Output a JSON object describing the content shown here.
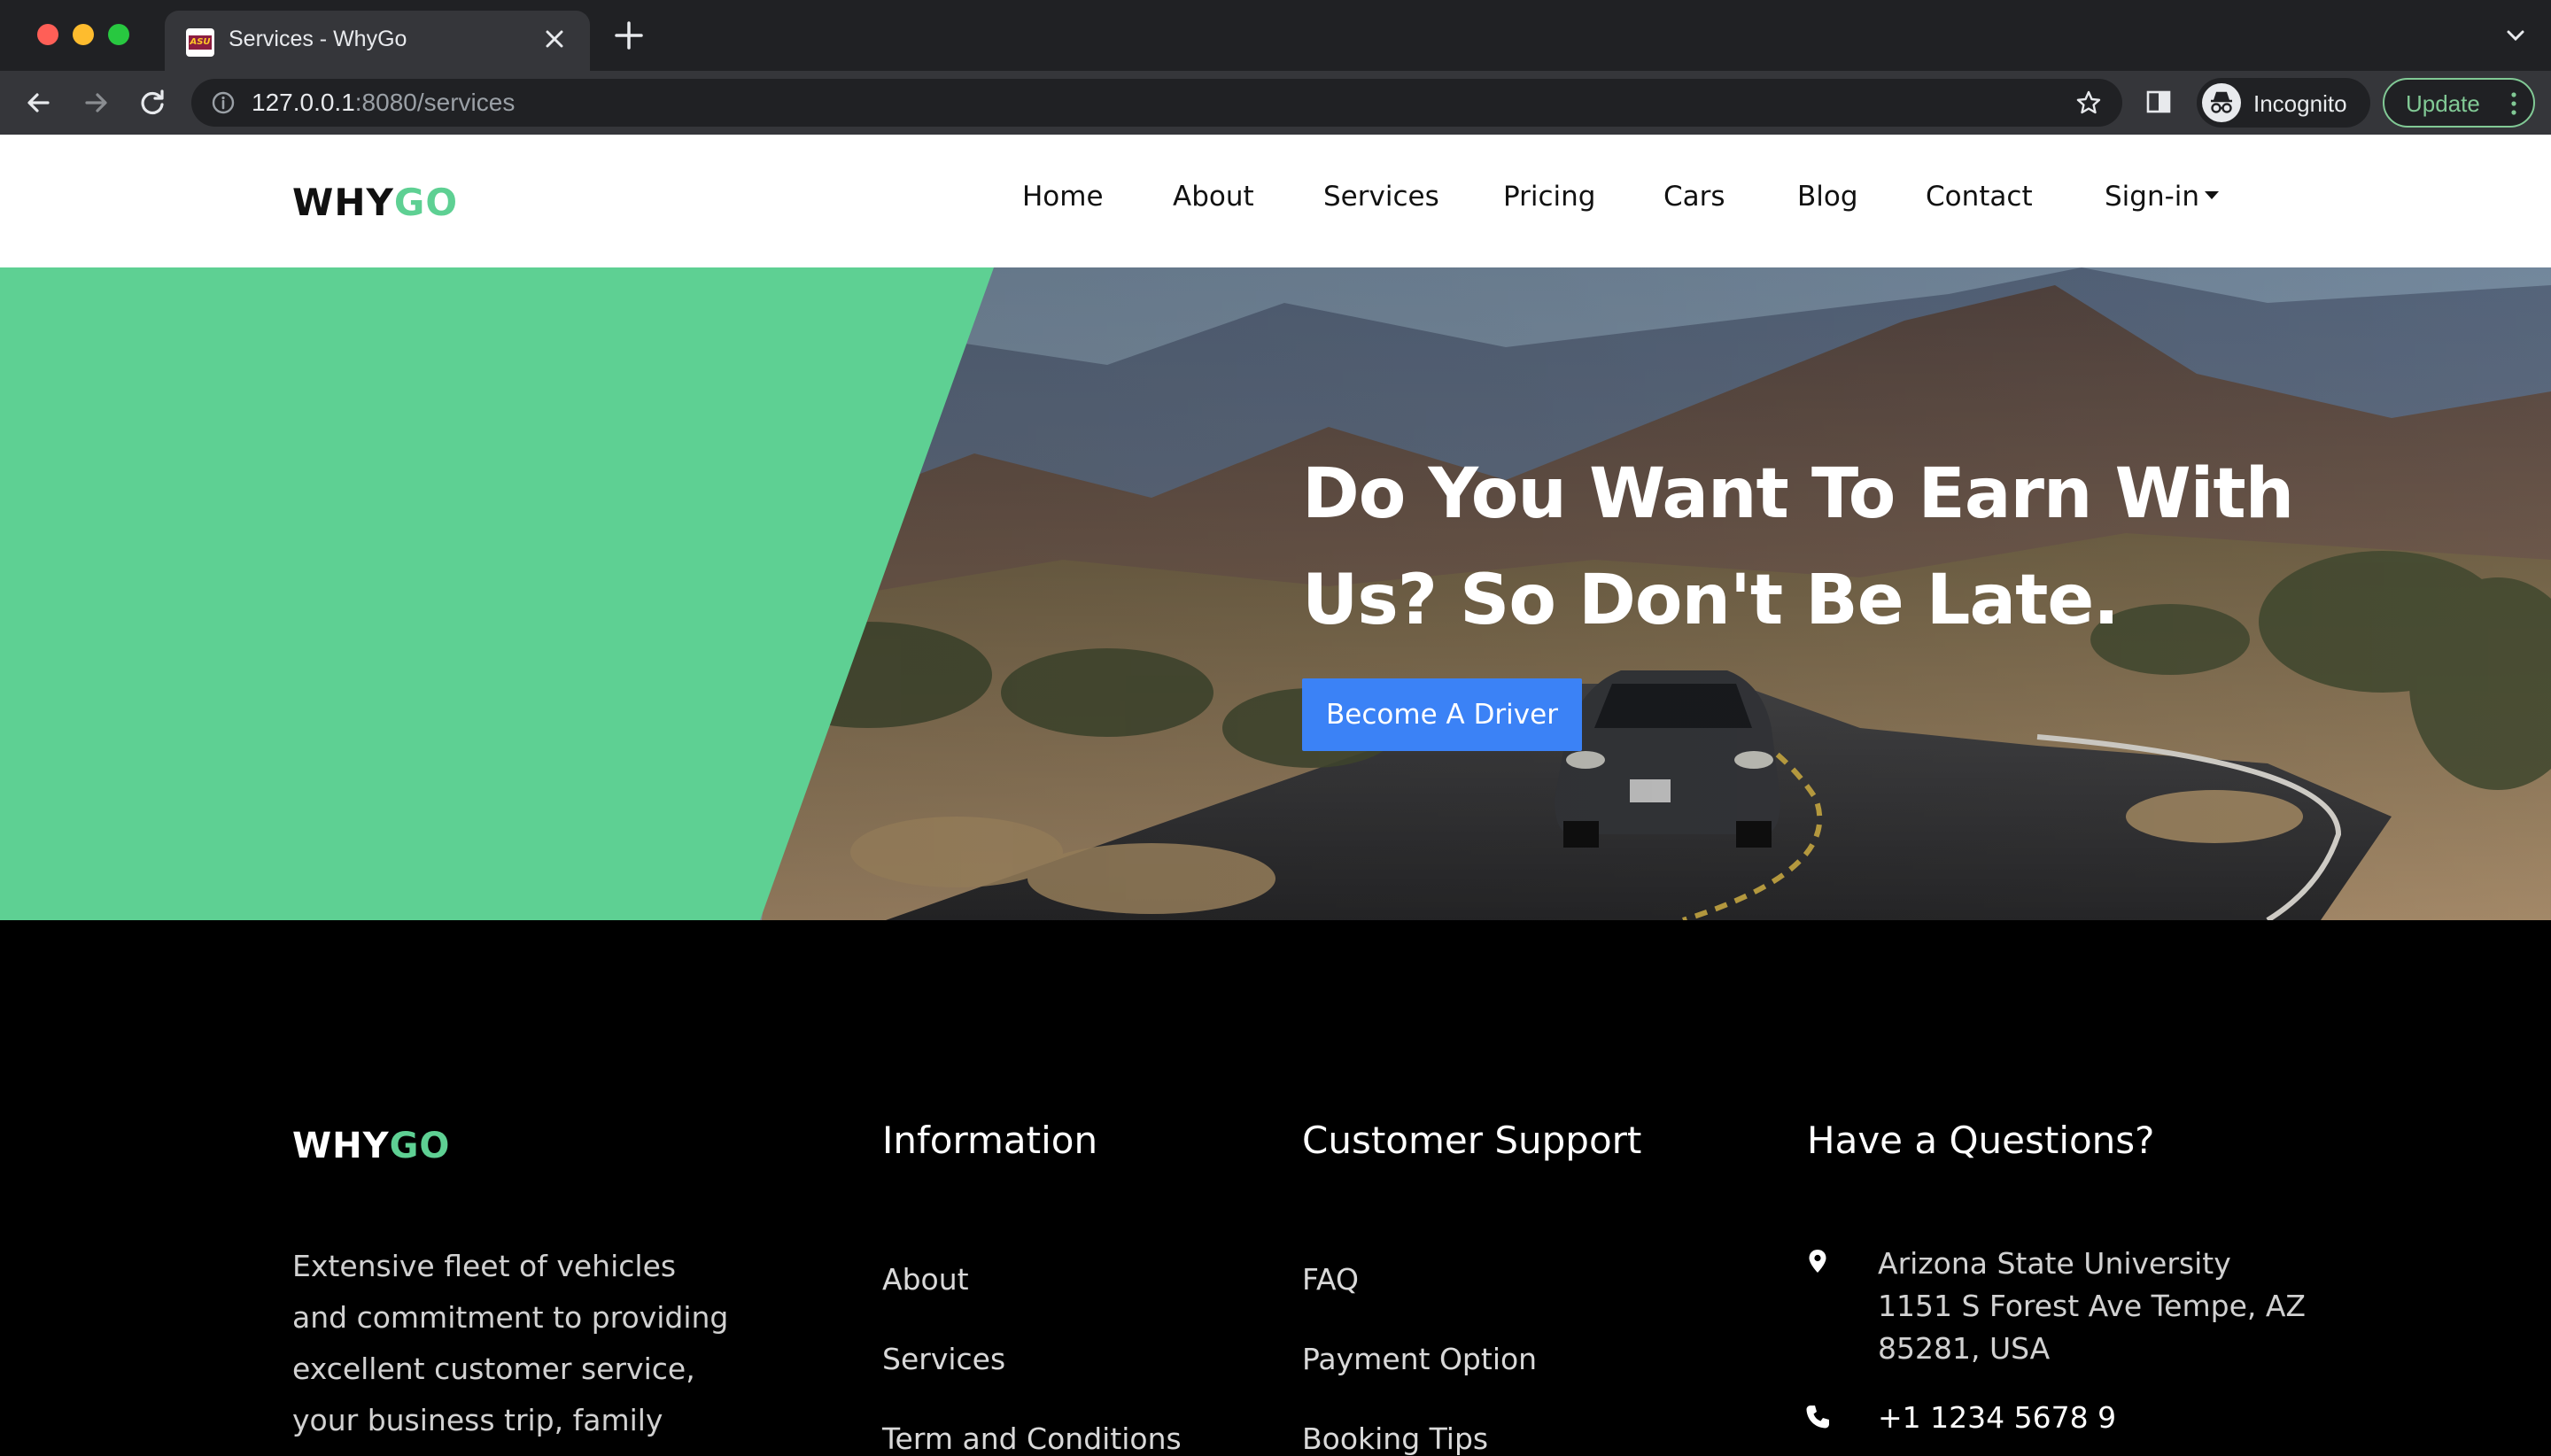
{
  "browser": {
    "tab_title": "Services - WhyGo",
    "favicon_text": "ASU",
    "url_host": "127.0.0.1",
    "url_path": ":8080/services",
    "profile_label": "Incognito",
    "update_label": "Update"
  },
  "header": {
    "logo_main": "WHY",
    "logo_accent": "GO",
    "nav": [
      "Home",
      "About",
      "Services",
      "Pricing",
      "Cars",
      "Blog",
      "Contact",
      "Sign-in"
    ]
  },
  "hero": {
    "heading": "Do You Want To Earn With Us? So Don't Be Late.",
    "button_label": "Become A Driver"
  },
  "footer": {
    "logo_main": "WHY",
    "logo_accent": "GO",
    "description": "Extensive fleet of vehicles and commitment to providing excellent customer service, your business trip, family",
    "information_title": "Information",
    "information_links": [
      "About",
      "Services",
      "Term and Conditions"
    ],
    "support_title": "Customer Support",
    "support_links": [
      "FAQ",
      "Payment Option",
      "Booking Tips"
    ],
    "questions_title": "Have a Questions?",
    "address_line1": "Arizona State University",
    "address_line2": "1151 S Forest Ave Tempe, AZ",
    "address_line3": "85281, USA",
    "phone": "+1 1234 5678 9"
  },
  "colors": {
    "accent_green": "#5ed093",
    "button_blue": "#3b82f6",
    "chrome_dark": "#202124",
    "chrome_toolbar": "#35363a"
  },
  "icons": {
    "tab_close": "close-icon",
    "new_tab": "plus-icon",
    "back": "arrow-left-icon",
    "forward": "arrow-right-icon",
    "reload": "reload-icon",
    "site_info": "info-icon",
    "bookmark": "star-icon",
    "side_panel": "side-panel-icon",
    "incognito": "incognito-icon",
    "menu": "kebab-menu-icon",
    "address": "map-pin-icon",
    "phone": "phone-icon"
  }
}
